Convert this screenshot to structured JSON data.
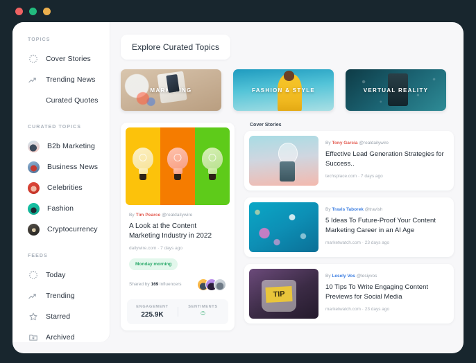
{
  "window": {
    "traffic_lights": [
      "close",
      "minimize",
      "maximize"
    ],
    "colors": {
      "close": "#ef6262",
      "minimize": "#22bb7e",
      "maximize": "#ecb04e",
      "chrome": "#18262e"
    }
  },
  "sidebar": {
    "sections": [
      {
        "label": "TOPICS",
        "items": [
          {
            "label": "Cover Stories",
            "icon": "spinner-dots-icon"
          },
          {
            "label": "Trending News",
            "icon": "trend-arrow-icon"
          },
          {
            "label": "Curated Quotes",
            "icon": "none"
          }
        ]
      },
      {
        "label": "CURATED TOPICS",
        "items": [
          {
            "label": "B2b Marketing",
            "icon": "avatar-b2b-marketing"
          },
          {
            "label": "Business News",
            "icon": "avatar-business-news"
          },
          {
            "label": "Celebrities",
            "icon": "avatar-celebrities"
          },
          {
            "label": "Fashion",
            "icon": "avatar-fashion"
          },
          {
            "label": "Cryptocurrency",
            "icon": "avatar-cryptocurrency"
          }
        ]
      },
      {
        "label": "FEEDS",
        "items": [
          {
            "label": "Today",
            "icon": "spinner-dots-icon"
          },
          {
            "label": "Trending",
            "icon": "trend-arrow-icon"
          },
          {
            "label": "Starred",
            "icon": "star-icon"
          },
          {
            "label": "Archived",
            "icon": "folder-download-icon"
          }
        ]
      }
    ]
  },
  "main": {
    "explore_tab": "Explore Curated Topics",
    "categories": [
      {
        "caption": "MARKETING",
        "image": "marketing-desk-photo"
      },
      {
        "caption": "FASHION & STYLE",
        "image": "fashion-model-photo"
      },
      {
        "caption": "VERTUAL REALITY",
        "image": "vr-headset-photo"
      }
    ],
    "feature": {
      "image": "three-lightbulbs-photo",
      "by_prefix": "By",
      "author": "Tim Pearce",
      "handle": "@realdailywire",
      "title": "A Look at the Content Marketing Industry in 2022",
      "source": "dailywire.com · 7 days ago",
      "tag": "Monday morning",
      "shared_prefix": "Shared by",
      "shared_count": "169",
      "shared_suffix": "influencers",
      "stats": [
        {
          "label": "ENGAGEMENT",
          "value": "225.9K"
        },
        {
          "label": "SENTIMENTS",
          "value": "☺"
        }
      ]
    },
    "cover_stories_label": "Cover Stories",
    "news": [
      {
        "thumb": "lightbulb-hand-photo",
        "by_prefix": "By",
        "author": "Tony Garcia",
        "handle": "@realdailywire",
        "title": "Effective Lead Generation Strategies for Success..",
        "source": "techsplace.com · 7 days ago"
      },
      {
        "thumb": "bokeh-lights-photo",
        "by_prefix": "By",
        "author": "Travis Taborek",
        "handle": "@travish",
        "title": "5 Ideas To Future-Proof Your Content Marketing Career in an AI Age",
        "source": "marketwatch.com · 23 days ago"
      },
      {
        "thumb": "tip-jar-photo",
        "by_prefix": "By",
        "author": "Lesely Vos",
        "handle": "@lesiyvos",
        "title": "10 Tips To Write Engaging Content Previews for Social Media",
        "source": "marketwatch.com · 23 days ago"
      }
    ]
  }
}
